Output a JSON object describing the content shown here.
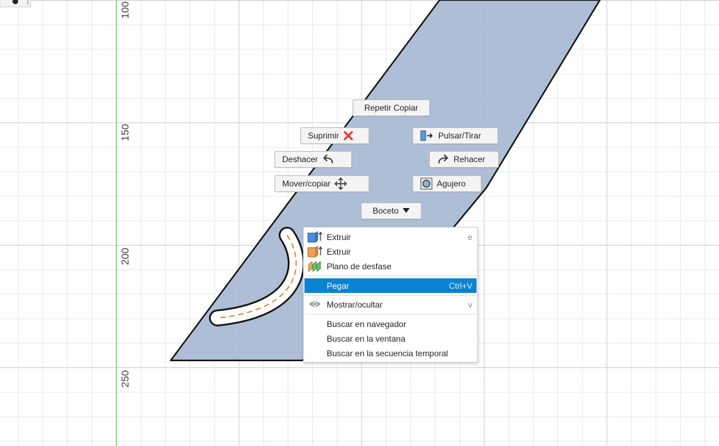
{
  "ruler": {
    "labels": [
      "100",
      "150",
      "200",
      "250"
    ]
  },
  "marking_menu": {
    "repeat": "Repetir Copiar",
    "delete": "Suprimir",
    "press_pull": "Pulsar/Tirar",
    "undo": "Deshacer",
    "redo": "Rehacer",
    "move_copy": "Mover/copiar",
    "hole": "Agujero",
    "sketch": "Boceto"
  },
  "context_menu": {
    "items": [
      {
        "label": "Extruir",
        "shortcut": "e",
        "icon": "extrude-blue-icon"
      },
      {
        "label": "Extruir",
        "shortcut": "",
        "icon": "extrude-orange-icon"
      },
      {
        "label": "Plano de desfase",
        "shortcut": "",
        "icon": "offset-plane-icon"
      },
      {
        "label": "Pegar",
        "shortcut": "Ctrl+V",
        "icon": ""
      },
      {
        "label": "Mostrar/ocultar",
        "shortcut": "v",
        "icon": "eye-icon"
      },
      {
        "label": "Buscar en navegador",
        "shortcut": "",
        "icon": ""
      },
      {
        "label": "Buscar en la ventana",
        "shortcut": "",
        "icon": ""
      },
      {
        "label": "Buscar en la secuencia temporal",
        "shortcut": "",
        "icon": ""
      }
    ]
  },
  "colors": {
    "profile_fill": "#a7b8d2",
    "highlight": "#0a84d0",
    "axis_green": "#7cd67c",
    "delete_red": "#e8373a"
  }
}
